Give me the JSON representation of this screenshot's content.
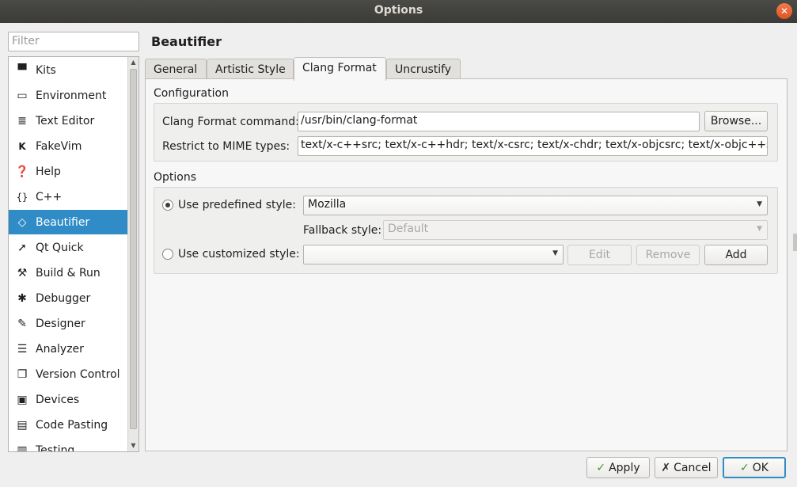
{
  "window": {
    "title": "Options"
  },
  "filter": {
    "placeholder": "Filter"
  },
  "sidebar": {
    "items": [
      {
        "label": "Kits",
        "icon": "kits-icon"
      },
      {
        "label": "Environment",
        "icon": "monitor-icon"
      },
      {
        "label": "Text Editor",
        "icon": "text-editor-icon"
      },
      {
        "label": "FakeVim",
        "icon": "fakevim-icon"
      },
      {
        "label": "Help",
        "icon": "help-icon"
      },
      {
        "label": "C++",
        "icon": "braces-icon"
      },
      {
        "label": "Beautifier",
        "icon": "diamond-icon",
        "active": true
      },
      {
        "label": "Qt Quick",
        "icon": "qt-quick-icon"
      },
      {
        "label": "Build & Run",
        "icon": "hammer-icon"
      },
      {
        "label": "Debugger",
        "icon": "bug-icon"
      },
      {
        "label": "Designer",
        "icon": "pencil-icon"
      },
      {
        "label": "Analyzer",
        "icon": "analyzer-icon"
      },
      {
        "label": "Version Control",
        "icon": "version-control-icon"
      },
      {
        "label": "Devices",
        "icon": "devices-icon"
      },
      {
        "label": "Code Pasting",
        "icon": "code-pasting-icon"
      },
      {
        "label": "Testing",
        "icon": "testing-icon"
      }
    ]
  },
  "page": {
    "heading": "Beautifier"
  },
  "tabs": [
    {
      "label": "General"
    },
    {
      "label": "Artistic Style"
    },
    {
      "label": "Clang Format",
      "active": true
    },
    {
      "label": "Uncrustify"
    }
  ],
  "configuration": {
    "title": "Configuration",
    "command_label": "Clang Format command:",
    "command_value": "/usr/bin/clang-format",
    "browse_label": "Browse...",
    "mime_label": "Restrict to MIME types:",
    "mime_value": "text/x-c++src; text/x-c++hdr; text/x-csrc; text/x-chdr; text/x-objcsrc; text/x-objc++src"
  },
  "options": {
    "title": "Options",
    "predefined_label": "Use predefined style:",
    "predefined_value": "Mozilla",
    "predefined_checked": true,
    "fallback_label": "Fallback style:",
    "fallback_value": "Default",
    "customized_label": "Use customized style:",
    "customized_value": "",
    "edit_label": "Edit",
    "remove_label": "Remove",
    "add_label": "Add"
  },
  "footer": {
    "apply_label": "Apply",
    "cancel_label": "Cancel",
    "ok_label": "OK"
  },
  "colors": {
    "selection": "#308cc6",
    "titlebar": "#3c3b37",
    "close": "#e0531f"
  }
}
